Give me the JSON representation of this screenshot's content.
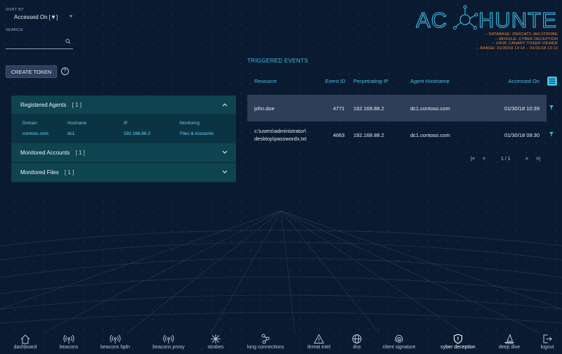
{
  "sort": {
    "label": "SORT BY",
    "value": "Accessed On [▼]"
  },
  "search": {
    "label": "SEARCH",
    "placeholder": ""
  },
  "create_token_label": "CREATE TOKEN",
  "help_symbol": "?",
  "panel": {
    "registered_agents": {
      "title": "Registered Agents",
      "count": "[ 1 ]",
      "columns": [
        "Domain",
        "Hostname",
        "IP",
        "Monitoring"
      ],
      "rows": [
        {
          "domain": "contoso.com",
          "hostname": "dc1",
          "ip": "192.168.88.2",
          "monitoring": "Files & Accounts"
        }
      ]
    },
    "monitored_accounts": {
      "title": "Monitored Accounts",
      "count": "[ 1 ]"
    },
    "monitored_files": {
      "title": "Monitored Files",
      "count": "[ 1 ]"
    }
  },
  "logo": {
    "text_left": "AC",
    "text_right": "HUNTER"
  },
  "meta": {
    "database": "-- DATABASE: DNSCAT2-JA3-STROBE",
    "module": "-- MODULE: CYBER DECEPTION",
    "view": "-- VIEW: CANARY TOKEN VIEWER",
    "range": "-- RANGE: 01/30/18 13:14 -- 01/31/18 13:13"
  },
  "events": {
    "title": "TRIGGERED EVENTS",
    "columns": {
      "resource": "Resource",
      "event_id": "Event ID",
      "perp_ip": "Perpetrating IP",
      "agent_host": "Agent Hostname",
      "accessed_on": "Accessed On"
    },
    "rows": [
      {
        "resource": "john.doe",
        "resource_line2": "",
        "event_id": "4771",
        "perp_ip": "192.168.88.2",
        "agent_host": "dc1.contoso.com",
        "accessed_on": "01/30/18 10:39"
      },
      {
        "resource": "c:\\users\\administrator\\",
        "resource_line2": "desktop\\passwords.txt",
        "event_id": "4663",
        "perp_ip": "192.168.88.2",
        "agent_host": "dc1.contoso.com",
        "accessed_on": "01/30/18 09:30"
      }
    ],
    "pager": {
      "first": "|<",
      "prev": "<",
      "page": "1 / 1",
      "next": ">",
      "last": ">|"
    }
  },
  "nav": [
    {
      "id": "dashboard",
      "label": "dashboard",
      "icon": "home-icon"
    },
    {
      "id": "beacons",
      "label": "beacons",
      "icon": "broadcast-icon"
    },
    {
      "id": "beacons-fqdn",
      "label": "beacons fqdn",
      "icon": "broadcast-icon"
    },
    {
      "id": "beacons-proxy",
      "label": "beacons proxy",
      "icon": "broadcast-icon"
    },
    {
      "id": "strobes",
      "label": "strobes",
      "icon": "burst-icon"
    },
    {
      "id": "long-connections",
      "label": "long connections",
      "icon": "nodes-icon"
    },
    {
      "id": "threat-intel",
      "label": "threat intel",
      "icon": "warning-icon"
    },
    {
      "id": "dns",
      "label": "dns",
      "icon": "globe-icon"
    },
    {
      "id": "client-signature",
      "label": "client signature",
      "icon": "fingerprint-icon"
    },
    {
      "id": "cyber-deception",
      "label": "cyber deception",
      "icon": "shield-alert-icon",
      "active": true
    },
    {
      "id": "deep-dive",
      "label": "deep dive",
      "icon": "sail-icon"
    },
    {
      "id": "logout",
      "label": "logout",
      "icon": "logout-icon"
    }
  ],
  "colors": {
    "accent": "#3ec0e6",
    "meta_orange": "#ff8a2b",
    "panel_teal": "#0e4350",
    "selected_row": "#2f3e58"
  }
}
